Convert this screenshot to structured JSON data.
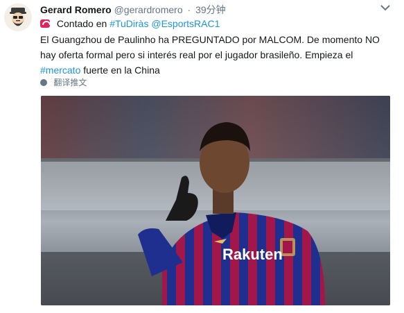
{
  "user": {
    "name": "Gerard Romero",
    "handle": "@gerardromero",
    "separator": "·",
    "time": "39分钟"
  },
  "context": {
    "prefix": "Contado en",
    "hashtag": "#TuDiràs",
    "mention": "@EsportsRAC1"
  },
  "tweet": {
    "text_before": "El Guangzhou de Paulinho ha PREGUNTADO por MALCOM. De momento NO hay oferta formal pero si interés real por el jugador brasileño. Empieza el ",
    "hashtag": "#mercato",
    "text_after": " fuerte en la China"
  },
  "translate_label": "翻译推文",
  "media": {
    "shirt_sponsor": "Rakuten"
  },
  "colors": {
    "link": "#1b95e0",
    "muted": "#657786",
    "phone_icon": "#e0245e",
    "shirt_blue": "#1f2f8f",
    "shirt_red": "#a3164a"
  },
  "icons": [
    "avatar-illustration",
    "chevron-down-icon",
    "phone-icon",
    "globe-icon"
  ]
}
